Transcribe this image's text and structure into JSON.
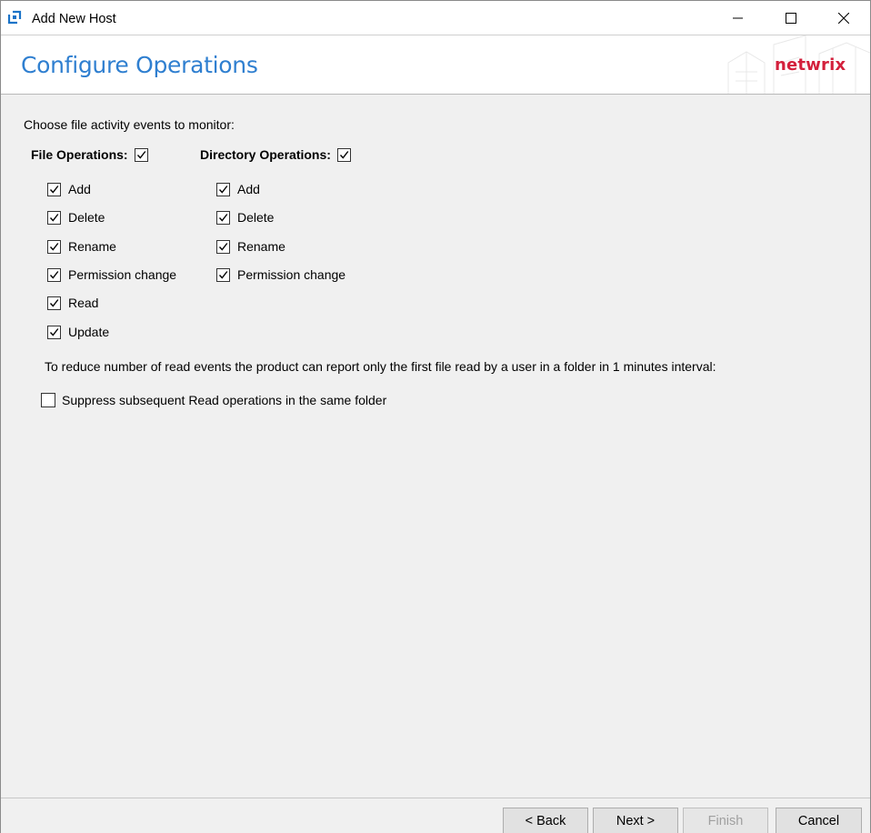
{
  "window": {
    "title": "Add New Host",
    "controls": {
      "minimize": "minimize",
      "maximize": "maximize",
      "close": "close"
    }
  },
  "header": {
    "title": "Configure Operations",
    "logo_text": "netwrix",
    "accent_color": "#2f7fd0",
    "logo_color": "#d3203c"
  },
  "content": {
    "intro": "Choose file activity events to monitor:",
    "file_operations": {
      "label": "File Operations:",
      "checked": true,
      "items": [
        {
          "label": "Add",
          "checked": true
        },
        {
          "label": "Delete",
          "checked": true
        },
        {
          "label": "Rename",
          "checked": true
        },
        {
          "label": "Permission change",
          "checked": true
        },
        {
          "label": "Read",
          "checked": true
        },
        {
          "label": "Update",
          "checked": true
        }
      ]
    },
    "directory_operations": {
      "label": "Directory Operations:",
      "checked": true,
      "items": [
        {
          "label": "Add",
          "checked": true
        },
        {
          "label": "Delete",
          "checked": true
        },
        {
          "label": "Rename",
          "checked": true
        },
        {
          "label": "Permission change",
          "checked": true
        }
      ]
    },
    "note": "To reduce number of read events the product can report only the first file read by a user in a folder in 1 minutes interval:",
    "suppress": {
      "label": "Suppress subsequent Read operations in the same folder",
      "checked": false
    }
  },
  "footer": {
    "back_label": "< Back",
    "next_label": "Next >",
    "finish_label": "Finish",
    "cancel_label": "Cancel"
  }
}
